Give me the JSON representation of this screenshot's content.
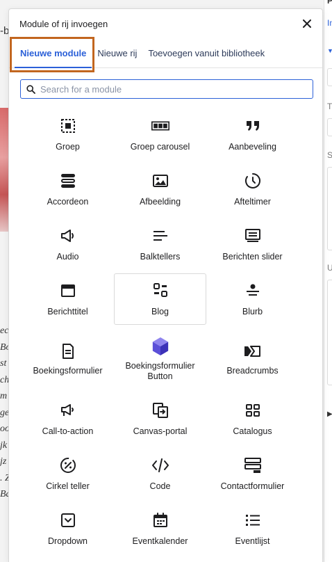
{
  "background": {
    "left_fragment": "-b",
    "text_lines": [
      "ec",
      "Bo",
      "st",
      "ch",
      "m",
      "ge",
      "oo",
      "jk",
      "jz",
      ". Z",
      "Ba"
    ],
    "right_labels": [
      "P",
      "In",
      "Ti",
      "Sa",
      "U"
    ]
  },
  "modal": {
    "title": "Module of rij invoegen",
    "tabs": [
      {
        "label": "Nieuwe module",
        "active": true
      },
      {
        "label": "Nieuwe rij",
        "active": false
      },
      {
        "label": "Toevoegen vanuit bibliotheek",
        "active": false
      }
    ],
    "search": {
      "placeholder": "Search for a module",
      "value": ""
    },
    "accent_color": "#2b60d8",
    "highlight_color": "#c2661f",
    "modules": [
      {
        "label": "Groep",
        "icon": "group-icon"
      },
      {
        "label": "Groep carousel",
        "icon": "group-carousel-icon"
      },
      {
        "label": "Aanbeveling",
        "icon": "quote-icon"
      },
      {
        "label": "Accordeon",
        "icon": "accordion-icon"
      },
      {
        "label": "Afbeelding",
        "icon": "image-icon"
      },
      {
        "label": "Afteltimer",
        "icon": "clock-icon"
      },
      {
        "label": "Audio",
        "icon": "speaker-icon"
      },
      {
        "label": "Balktellers",
        "icon": "bar-counters-icon"
      },
      {
        "label": "Berichten slider",
        "icon": "post-slider-icon"
      },
      {
        "label": "Berichttitel",
        "icon": "post-title-icon"
      },
      {
        "label": "Blog",
        "icon": "blog-icon"
      },
      {
        "label": "Blurb",
        "icon": "blurb-icon"
      },
      {
        "label": "Boekingsformulier",
        "icon": "booking-form-icon"
      },
      {
        "label": "Boekingsformulier Button",
        "icon": "cube-logo-icon"
      },
      {
        "label": "Breadcrumbs",
        "icon": "breadcrumbs-icon"
      },
      {
        "label": "Call-to-action",
        "icon": "megaphone-icon"
      },
      {
        "label": "Canvas-portal",
        "icon": "canvas-portal-icon"
      },
      {
        "label": "Catalogus",
        "icon": "catalog-icon"
      },
      {
        "label": "Cirkel teller",
        "icon": "circle-counter-icon"
      },
      {
        "label": "Code",
        "icon": "code-icon"
      },
      {
        "label": "Contactformulier",
        "icon": "contact-form-icon"
      },
      {
        "label": "Dropdown",
        "icon": "dropdown-icon"
      },
      {
        "label": "Eventkalender",
        "icon": "calendar-icon"
      },
      {
        "label": "Eventlijst",
        "icon": "event-list-icon"
      }
    ]
  }
}
